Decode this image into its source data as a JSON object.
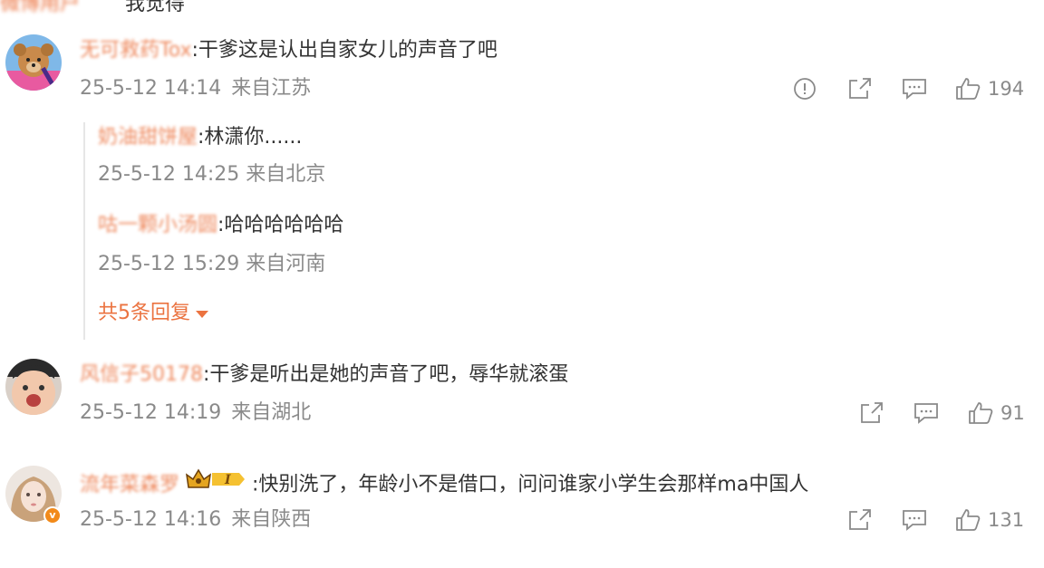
{
  "top_fragment": {
    "name": "微博用户",
    "text": "我觉得"
  },
  "comments": [
    {
      "user": "无可救药Tox",
      "text": ":干爹这是认出自家女儿的声音了吧",
      "time": "25-5-12 14:14",
      "location": "来自江苏",
      "likes": "194",
      "replies": [
        {
          "user": "奶油甜饼屋",
          "text": ":林潇你......",
          "time": "25-5-12 14:25",
          "location": "来自北京"
        },
        {
          "user": "咕一颗小汤圆",
          "text": ":哈哈哈哈哈哈",
          "time": "25-5-12 15:29",
          "location": "来自河南"
        }
      ],
      "more_replies": "共5条回复"
    },
    {
      "user": "风信子50178",
      "text": ":干爹是听出是她的声音了吧，辱华就滚蛋",
      "time": "25-5-12 14:19",
      "location": "来自湖北",
      "likes": "91"
    },
    {
      "user": "流年菜森罗",
      "badge_level": "I",
      "text": ":快别洗了，年龄小不是借口，问问谁家小学生会那样ma中国人",
      "time": "25-5-12 14:16",
      "location": "来自陕西",
      "likes": "131"
    }
  ],
  "icons": [
    "report-icon",
    "share-icon",
    "comment-icon",
    "like-icon",
    "verified-badge-icon",
    "crown-badge-icon",
    "chevron-down-icon"
  ],
  "colors": {
    "username": "#eb7340",
    "meta": "#8a8a8a",
    "text": "#333333",
    "badge": "#f28a1a"
  }
}
